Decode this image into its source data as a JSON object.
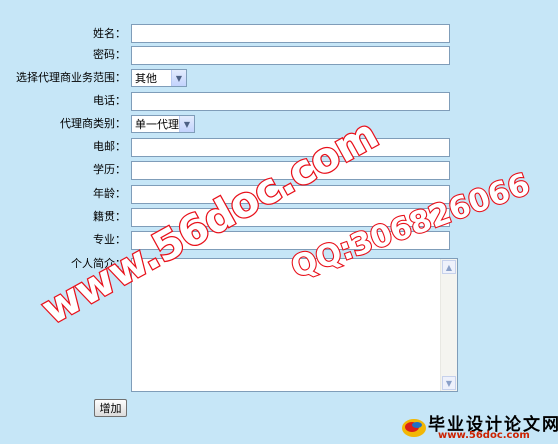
{
  "form": {
    "name_label": "姓名：",
    "password_label": "密码：",
    "agency_scope_label": "选择代理商业务范围：",
    "agency_scope_value": "其他",
    "phone_label": "电话：",
    "agent_type_label": "代理商类别：",
    "agent_type_value": "单一代理",
    "email_label": "电邮：",
    "education_label": "学历：",
    "age_label": "年龄：",
    "hometown_label": "籍贯：",
    "major_label": "专业：",
    "bio_label": "个人简介：",
    "submit_label": "增加"
  },
  "watermark": {
    "site_text": "www.56doc.com",
    "qq_text": "QQ:306826066",
    "logo_title": "毕业设计论文网",
    "logo_url": "www.56doc.com"
  },
  "colors": {
    "background": "#c6e6f7",
    "watermark_stroke": "#e8101a",
    "input_border": "#7f9db9"
  }
}
